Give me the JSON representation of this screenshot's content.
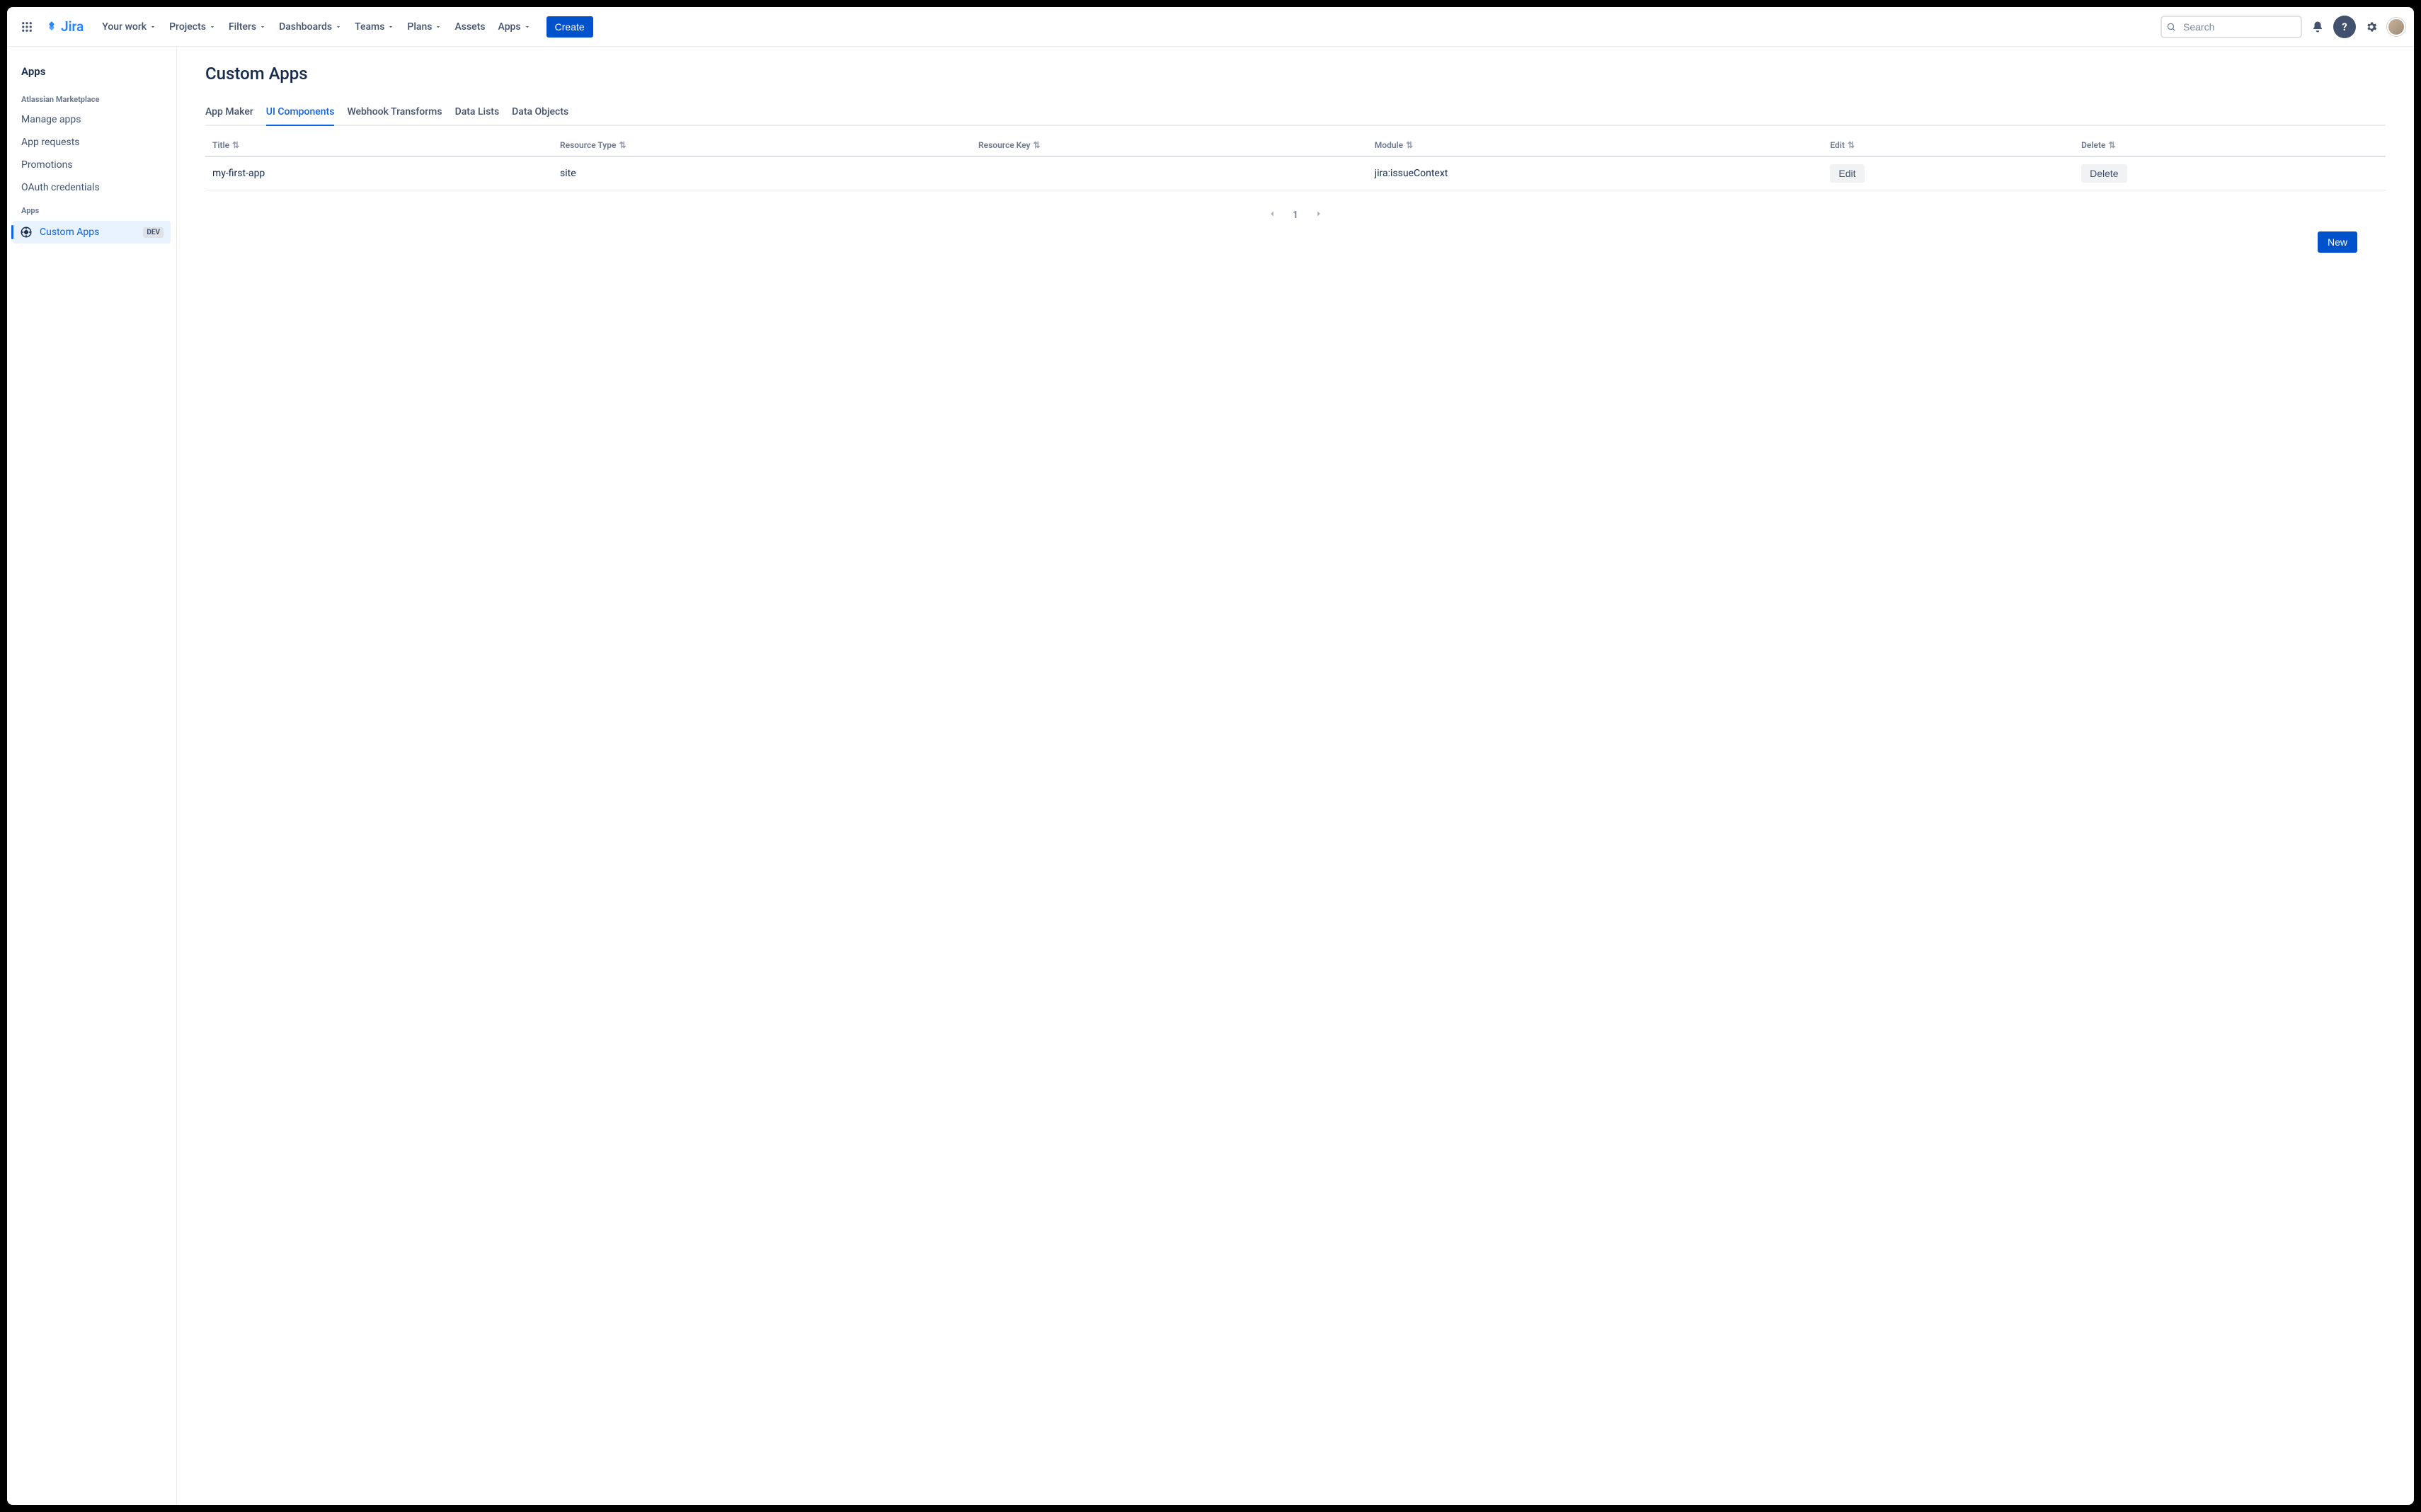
{
  "topnav": {
    "product": "Jira",
    "items": [
      {
        "label": "Your work",
        "caret": true
      },
      {
        "label": "Projects",
        "caret": true
      },
      {
        "label": "Filters",
        "caret": true
      },
      {
        "label": "Dashboards",
        "caret": true
      },
      {
        "label": "Teams",
        "caret": true
      },
      {
        "label": "Plans",
        "caret": true
      },
      {
        "label": "Assets",
        "caret": false
      },
      {
        "label": "Apps",
        "caret": true
      }
    ],
    "create_label": "Create",
    "search_placeholder": "Search"
  },
  "sidebar": {
    "title": "Apps",
    "section_marketplace": "Atlassian Marketplace",
    "marketplace_links": [
      "Manage apps",
      "App requests",
      "Promotions",
      "OAuth credentials"
    ],
    "section_apps": "Apps",
    "active_item": {
      "label": "Custom Apps",
      "badge": "DEV"
    }
  },
  "main": {
    "page_title": "Custom Apps",
    "tabs": [
      "App Maker",
      "UI Components",
      "Webhook Transforms",
      "Data Lists",
      "Data Objects"
    ],
    "active_tab_index": 1,
    "columns": [
      "Title",
      "Resource Type",
      "Resource Key",
      "Module",
      "Edit",
      "Delete"
    ],
    "rows": [
      {
        "title": "my-first-app",
        "resource_type": "site",
        "resource_key": "",
        "module": "jira:issueContext",
        "edit": "Edit",
        "delete": "Delete"
      }
    ],
    "pager": {
      "current": "1"
    },
    "new_label": "New"
  }
}
